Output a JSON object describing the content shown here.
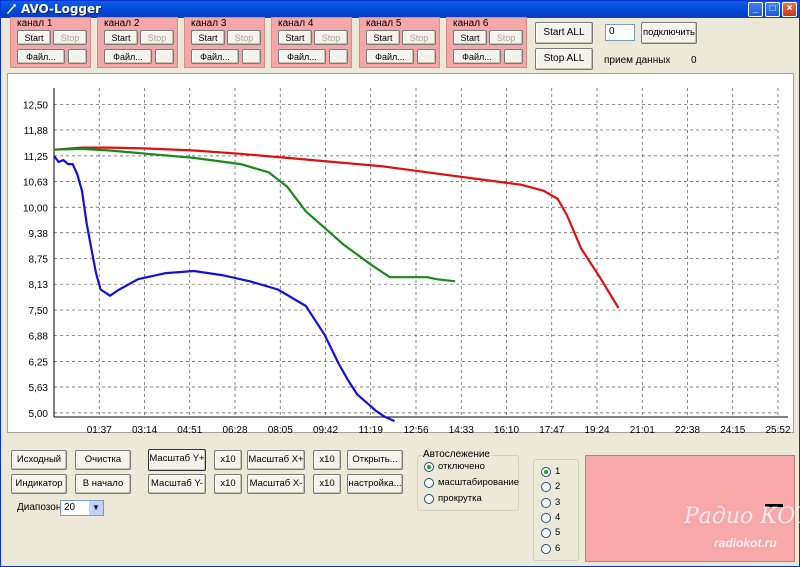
{
  "window": {
    "title": "AVO-Logger"
  },
  "channels": [
    {
      "label": "канал 1",
      "start": "Start",
      "stop": "Stop",
      "file": "Файл..."
    },
    {
      "label": "канал 2",
      "start": "Start",
      "stop": "Stop",
      "file": "Файл..."
    },
    {
      "label": "канал 3",
      "start": "Start",
      "stop": "Stop",
      "file": "Файл..."
    },
    {
      "label": "канал 4",
      "start": "Start",
      "stop": "Stop",
      "file": "Файл..."
    },
    {
      "label": "канал 5",
      "start": "Start",
      "stop": "Stop",
      "file": "Файл..."
    },
    {
      "label": "канал 6",
      "start": "Start",
      "stop": "Stop",
      "file": "Файл..."
    }
  ],
  "top": {
    "start_all": "Start ALL",
    "stop_all": "Stop ALL",
    "port_value": "0",
    "connect": "подключить",
    "rx_label": "прием данных",
    "rx_count": "0"
  },
  "chart_data": {
    "type": "line",
    "title": "",
    "xlabel": "",
    "ylabel": "",
    "grid": true,
    "y_ticks": [
      "12,50",
      "11,88",
      "11,25",
      "10,63",
      "10,00",
      "9,38",
      "8,75",
      "8,13",
      "7,50",
      "6,88",
      "6,25",
      "5,63",
      "5,00"
    ],
    "x_ticks": [
      "01:37",
      "03:14",
      "04:51",
      "06:28",
      "08:05",
      "09:42",
      "11:19",
      "12:56",
      "14:33",
      "16:10",
      "17:47",
      "19:24",
      "21:01",
      "22:38",
      "24:15",
      "25:52"
    ],
    "ylim": [
      4.9,
      12.9
    ],
    "xlim_minutes": [
      0,
      1552
    ],
    "series": [
      {
        "color": "#e01010",
        "x": [
          0,
          60,
          120,
          200,
          300,
          400,
          500,
          600,
          700,
          800,
          900,
          1000,
          1050,
          1080,
          1100,
          1130,
          1170,
          1210
        ],
        "y": [
          11.4,
          11.45,
          11.45,
          11.43,
          11.38,
          11.3,
          11.2,
          11.1,
          11.0,
          10.85,
          10.7,
          10.55,
          10.4,
          10.2,
          9.8,
          9.0,
          8.3,
          7.55
        ]
      },
      {
        "color": "#1a8a1a",
        "x": [
          0,
          60,
          120,
          200,
          300,
          400,
          460,
          500,
          540,
          580,
          620,
          680,
          720,
          760,
          800,
          820,
          860
        ],
        "y": [
          11.4,
          11.42,
          11.38,
          11.3,
          11.2,
          11.05,
          10.85,
          10.5,
          9.9,
          9.5,
          9.1,
          8.6,
          8.3,
          8.3,
          8.3,
          8.25,
          8.2
        ]
      },
      {
        "color": "#1010e0",
        "x": [
          0,
          10,
          20,
          30,
          40,
          50,
          60,
          70,
          80,
          90,
          100,
          120,
          140,
          180,
          240,
          300,
          360,
          420,
          480,
          540,
          580,
          610,
          630,
          650,
          670,
          690,
          710,
          730
        ],
        "y": [
          11.25,
          11.1,
          11.15,
          11.05,
          11.05,
          10.8,
          10.4,
          9.6,
          9.0,
          8.4,
          8.0,
          7.85,
          8.0,
          8.25,
          8.4,
          8.45,
          8.35,
          8.2,
          8.0,
          7.6,
          6.9,
          6.2,
          5.8,
          5.45,
          5.25,
          5.05,
          4.9,
          4.8
        ]
      }
    ]
  },
  "bottom": {
    "iskhodny": "Исходный",
    "ochistka": "Очистка",
    "scale_y_plus": "Масштаб Y+",
    "x10a": "x10",
    "scale_x_plus": "Масштаб X+",
    "x10b": "x10",
    "open": "Открыть...",
    "indicator": "Индикатор",
    "to_start": "В начало",
    "scale_y_minus": "Масштаб Y-",
    "x10c": "x10",
    "scale_x_minus": "Масштаб X-",
    "x10d": "x10",
    "settings": "настройка...",
    "range_label": "Диапозон",
    "range_value": "20",
    "track_title": "Автослежение",
    "track_opts": [
      "отключено",
      "масштабирование",
      "прокрутка"
    ],
    "chan_opts": [
      "1",
      "2",
      "3",
      "4",
      "5",
      "6"
    ]
  },
  "watermark": {
    "line1": "Радио КОТ",
    "line2": "radiokot.ru"
  }
}
